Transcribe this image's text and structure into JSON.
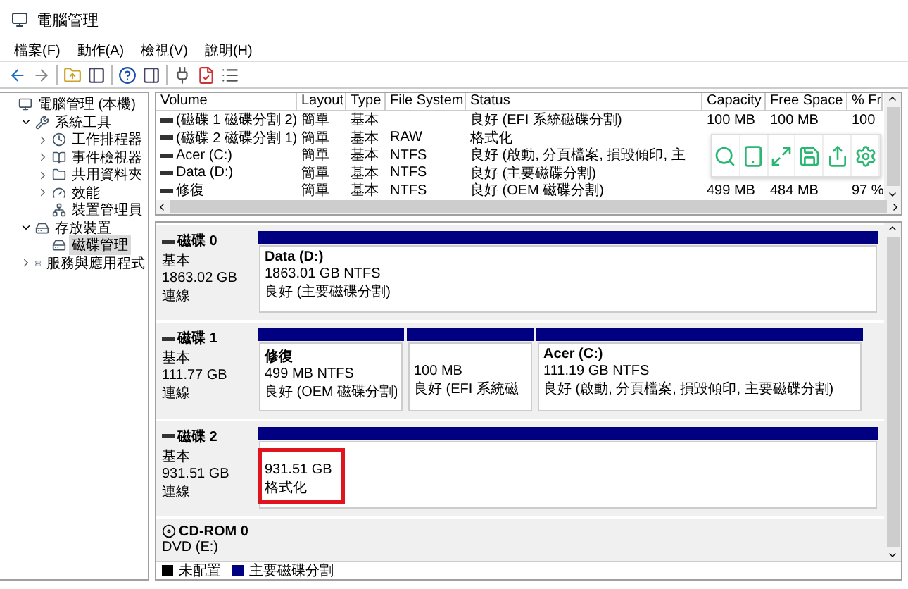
{
  "window": {
    "title": "電腦管理"
  },
  "menu": [
    "檔案(F)",
    "動作(A)",
    "檢視(V)",
    "說明(H)"
  ],
  "tree": [
    {
      "label": "電腦管理 (本機)",
      "selected": false,
      "children": [
        {
          "label": "系統工具",
          "expanded": true,
          "selected": false,
          "children": [
            {
              "label": "工作排程器",
              "expanded": false,
              "selected": false
            },
            {
              "label": "事件檢視器",
              "expanded": false,
              "selected": false
            },
            {
              "label": "共用資料夾",
              "expanded": false,
              "selected": false
            },
            {
              "label": "效能",
              "expanded": false,
              "selected": false
            },
            {
              "label": "裝置管理員",
              "selected": false
            }
          ]
        },
        {
          "label": "存放裝置",
          "expanded": true,
          "selected": false,
          "children": [
            {
              "label": "磁碟管理",
              "selected": true
            }
          ]
        },
        {
          "label": "服務與應用程式",
          "expanded": false,
          "selected": false
        }
      ]
    }
  ],
  "volume_list": {
    "columns": [
      "Volume",
      "Layout",
      "Type",
      "File System",
      "Status",
      "Capacity",
      "Free Space",
      "% Fr"
    ],
    "rows": [
      {
        "volume": "(磁碟 1 磁碟分割 2)",
        "layout": "簡單",
        "type": "基本",
        "status": "良好 (EFI 系統磁碟分割)",
        "capacity": "100 MB",
        "free_space": "100 MB",
        "pct_free": "100"
      },
      {
        "volume": "(磁碟 2 磁碟分割 1)",
        "layout": "簡單",
        "type": "基本",
        "file_system": "RAW",
        "status": "格式化"
      },
      {
        "volume": "Acer (C:)",
        "layout": "簡單",
        "type": "基本",
        "file_system": "NTFS",
        "status": "良好 (啟動, 分頁檔案, 損毀傾印, 主"
      },
      {
        "volume": "Data (D:)",
        "layout": "簡單",
        "type": "基本",
        "file_system": "NTFS",
        "status": "良好 (主要磁碟分割)"
      },
      {
        "volume": "修復",
        "layout": "簡單",
        "type": "基本",
        "file_system": "NTFS",
        "status": "良好 (OEM 磁碟分割)",
        "capacity": "499 MB",
        "free_space": "484 MB",
        "pct_free": "97 %"
      }
    ]
  },
  "disks": [
    {
      "kind": "disk",
      "name": "磁碟 0",
      "type": "基本",
      "size": "1863.02 GB",
      "state": "連線",
      "partitions": [
        {
          "name": "Data  (D:)",
          "size": "1863.01 GB NTFS",
          "status": "良好 (主要磁碟分割)",
          "highlighted": false
        }
      ]
    },
    {
      "kind": "disk",
      "name": "磁碟 1",
      "type": "基本",
      "size": "111.77 GB",
      "state": "連線",
      "partitions": [
        {
          "name": "修復",
          "size": "499 MB NTFS",
          "status": "良好 (OEM 磁碟分割)",
          "highlighted": false
        },
        {
          "size": "100 MB",
          "status": "良好 (EFI 系統磁",
          "highlighted": false
        },
        {
          "name": "Acer  (C:)",
          "size": "111.19 GB NTFS",
          "status": "良好 (啟動, 分頁檔案, 損毀傾印, 主要磁碟分割)",
          "highlighted": false
        }
      ]
    },
    {
      "kind": "disk",
      "name": "磁碟 2",
      "type": "基本",
      "size": "931.51 GB",
      "state": "連線",
      "partitions": [
        {
          "size": "931.51 GB",
          "status": "格式化",
          "highlighted": true
        }
      ]
    },
    {
      "kind": "cdrom",
      "name": "CD-ROM 0",
      "type": "DVD (E:)"
    }
  ],
  "legend": [
    {
      "label": "未配置",
      "color": "#000000"
    },
    {
      "label": "主要磁碟分割",
      "color": "#000080"
    }
  ]
}
